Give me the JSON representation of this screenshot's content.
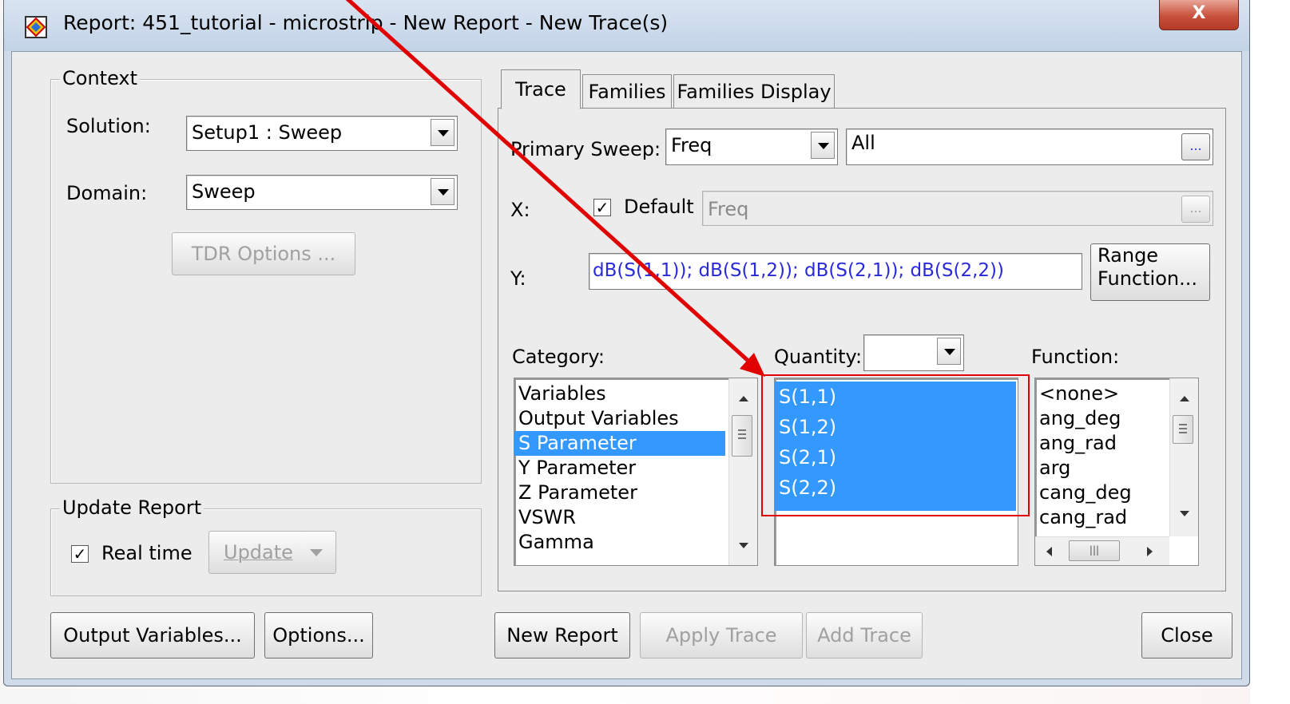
{
  "window": {
    "title": "Report: 451_tutorial - microstrip - New Report - New Trace(s)",
    "close_glyph": "X"
  },
  "context": {
    "group_label": "Context",
    "solution_label": "Solution:",
    "solution_value": "Setup1 : Sweep",
    "domain_label": "Domain:",
    "domain_value": "Sweep",
    "tdr_button": "TDR Options ..."
  },
  "update_report": {
    "group_label": "Update Report",
    "realtime_label": "Real time",
    "realtime_checked": true,
    "update_button": "Update"
  },
  "tabs": [
    {
      "label": "Trace",
      "active": true
    },
    {
      "label": "Families",
      "active": false
    },
    {
      "label": "Families Display",
      "active": false
    }
  ],
  "trace": {
    "primary_sweep_label": "Primary Sweep:",
    "primary_sweep_value": "Freq",
    "sweep_range_value": "All",
    "ellipsis": "...",
    "x_label": "X:",
    "x_default_label": "Default",
    "x_default_checked": true,
    "x_value": "Freq",
    "y_label": "Y:",
    "y_value": "dB(S(1,1)); dB(S(1,2)); dB(S(2,1)); dB(S(2,2))",
    "range_function_line1": "Range",
    "range_function_line2": "Function...",
    "category_label": "Category:",
    "quantity_label": "Quantity:",
    "function_label": "Function:",
    "categories": [
      "Variables",
      "Output Variables",
      "S Parameter",
      "Y Parameter",
      "Z Parameter",
      "VSWR",
      "Gamma"
    ],
    "category_selected": "S Parameter",
    "quantities": [
      "S(1,1)",
      "S(1,2)",
      "S(2,1)",
      "S(2,2)"
    ],
    "functions": [
      "<none>",
      "ang_deg",
      "ang_rad",
      "arg",
      "cang_deg",
      "cang_rad"
    ]
  },
  "bottom_buttons": {
    "output_variables": "Output Variables...",
    "options": "Options...",
    "new_report": "New Report",
    "apply_trace": "Apply Trace",
    "add_trace": "Add Trace",
    "close": "Close"
  },
  "annotation": {
    "arrow_color": "#e00000",
    "highlight_color": "#e00000"
  },
  "colors": {
    "selection": "#3399ff",
    "y_expression": "#2a2ad8"
  }
}
